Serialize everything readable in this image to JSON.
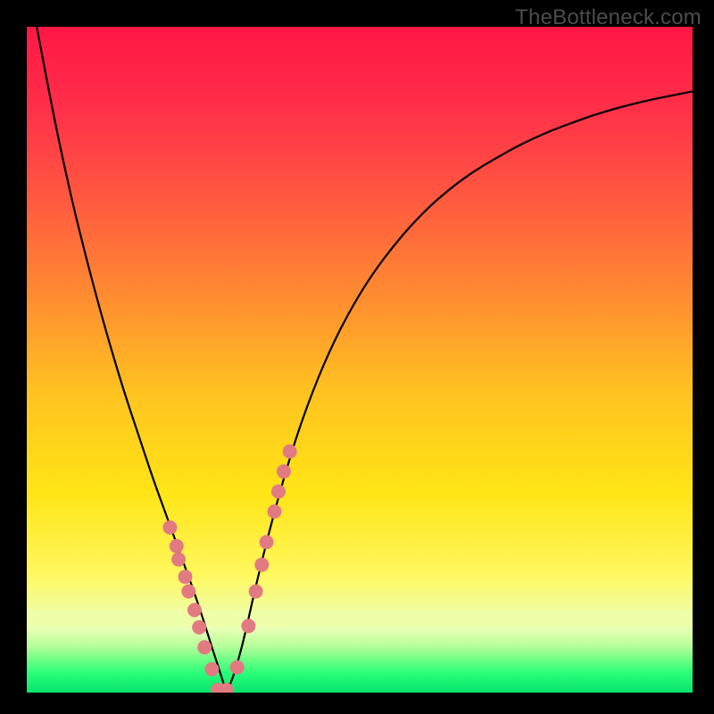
{
  "watermark": "TheBottleneck.com",
  "colors": {
    "frame": "#000000",
    "dot": "#e27a82",
    "curve": "#000000",
    "gradient_stops": [
      {
        "offset": 0.0,
        "color": "#ff1744"
      },
      {
        "offset": 0.12,
        "color": "#ff2f49"
      },
      {
        "offset": 0.25,
        "color": "#ff5640"
      },
      {
        "offset": 0.4,
        "color": "#ff8a31"
      },
      {
        "offset": 0.55,
        "color": "#ffc320"
      },
      {
        "offset": 0.7,
        "color": "#ffe516"
      },
      {
        "offset": 0.82,
        "color": "#fff85c"
      },
      {
        "offset": 0.885,
        "color": "#effea8"
      },
      {
        "offset": 0.905,
        "color": "#e7ffb2"
      },
      {
        "offset": 0.93,
        "color": "#b6ff9a"
      },
      {
        "offset": 0.95,
        "color": "#71ff86"
      },
      {
        "offset": 0.97,
        "color": "#2bff7a"
      },
      {
        "offset": 1.0,
        "color": "#06e46b"
      }
    ],
    "light_band_y_frac": 0.888
  },
  "chart_data": {
    "type": "line",
    "title": "",
    "xlabel": "",
    "ylabel": "",
    "xlim": [
      0,
      1
    ],
    "ylim": [
      0,
      1
    ],
    "curve": {
      "x": [
        0.015,
        0.03,
        0.05,
        0.07,
        0.09,
        0.11,
        0.13,
        0.15,
        0.17,
        0.19,
        0.21,
        0.23,
        0.25,
        0.265,
        0.279,
        0.293,
        0.3,
        0.31,
        0.325,
        0.345,
        0.37,
        0.4,
        0.43,
        0.46,
        0.49,
        0.52,
        0.55,
        0.58,
        0.61,
        0.64,
        0.67,
        0.7,
        0.73,
        0.76,
        0.79,
        0.82,
        0.85,
        0.88,
        0.91,
        0.94,
        0.97,
        1.0
      ],
      "y": [
        1.0,
        0.92,
        0.82,
        0.73,
        0.65,
        0.575,
        0.505,
        0.44,
        0.38,
        0.32,
        0.265,
        0.21,
        0.155,
        0.11,
        0.065,
        0.022,
        0.0,
        0.023,
        0.075,
        0.165,
        0.265,
        0.37,
        0.455,
        0.525,
        0.582,
        0.63,
        0.67,
        0.705,
        0.735,
        0.76,
        0.782,
        0.8,
        0.817,
        0.832,
        0.845,
        0.856,
        0.867,
        0.876,
        0.884,
        0.891,
        0.897,
        0.903
      ]
    },
    "dots": {
      "x": [
        0.215,
        0.225,
        0.228,
        0.238,
        0.243,
        0.252,
        0.259,
        0.267,
        0.278,
        0.287,
        0.3,
        0.316,
        0.333,
        0.344,
        0.353,
        0.36,
        0.372,
        0.378,
        0.386,
        0.395
      ],
      "y": [
        0.248,
        0.22,
        0.2,
        0.174,
        0.152,
        0.124,
        0.098,
        0.068,
        0.035,
        0.004,
        0.004,
        0.038,
        0.1,
        0.152,
        0.192,
        0.226,
        0.272,
        0.302,
        0.332,
        0.362
      ]
    },
    "annotations": []
  }
}
